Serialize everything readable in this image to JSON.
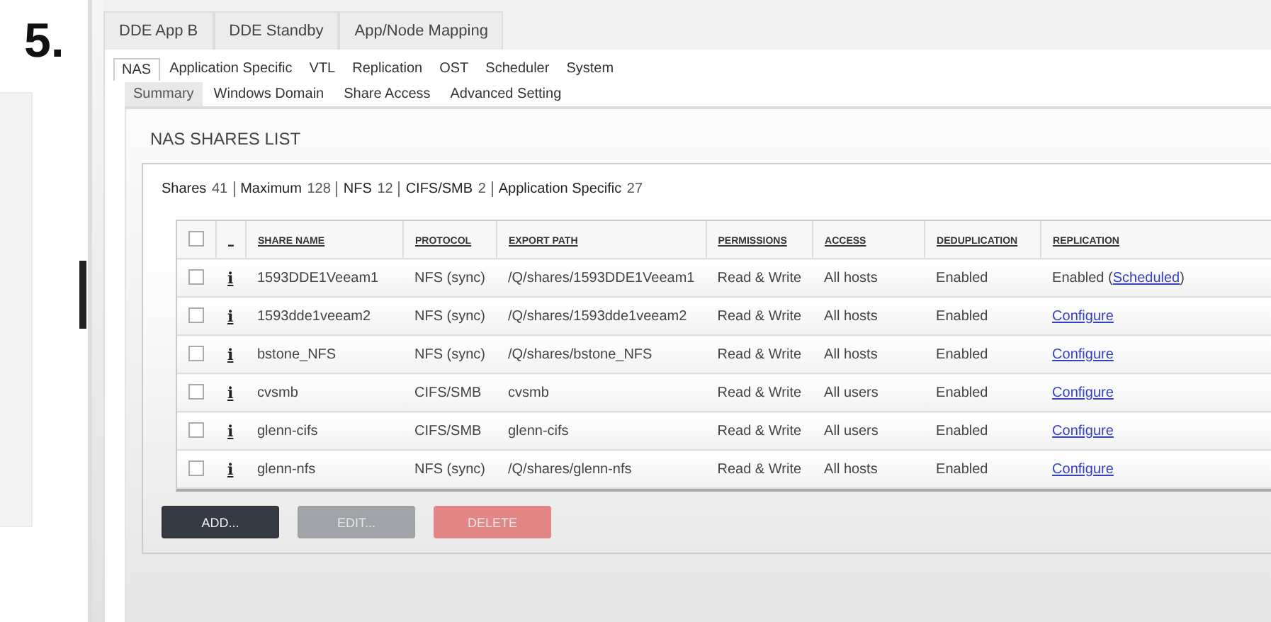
{
  "step_label": "5.",
  "top_tabs": [
    {
      "label": "DDE App B",
      "selected": false
    },
    {
      "label": "DDE Standby",
      "selected": false
    },
    {
      "label": "App/Node Mapping",
      "selected": false
    }
  ],
  "section_tabs": [
    {
      "label": "NAS",
      "selected": true
    },
    {
      "label": "Application Specific",
      "selected": false
    },
    {
      "label": "VTL",
      "selected": false
    },
    {
      "label": "Replication",
      "selected": false
    },
    {
      "label": "OST",
      "selected": false
    },
    {
      "label": "Scheduler",
      "selected": false
    },
    {
      "label": "System",
      "selected": false
    }
  ],
  "sub_tabs": [
    {
      "label": "Summary",
      "selected": true
    },
    {
      "label": "Windows Domain",
      "selected": false
    },
    {
      "label": "Share Access",
      "selected": false
    },
    {
      "label": "Advanced Setting",
      "selected": false
    }
  ],
  "heading": "NAS SHARES LIST",
  "stats": [
    {
      "label": "Shares",
      "value": "41"
    },
    {
      "label": "Maximum",
      "value": "128"
    },
    {
      "label": "NFS",
      "value": "12"
    },
    {
      "label": "CIFS/SMB",
      "value": "2"
    },
    {
      "label": "Application Specific",
      "value": "27"
    }
  ],
  "table": {
    "select_all_checked": false,
    "columns": [
      "_",
      "SHARE NAME",
      "PROTOCOL",
      "EXPORT PATH",
      "PERMISSIONS",
      "ACCESS",
      "DEDUPLICATION",
      "REPLICATION"
    ],
    "rows": [
      {
        "checked": false,
        "info": "i",
        "name": "1593DDE1Veeam1",
        "protocol": "NFS (sync)",
        "path": "/Q/shares/1593DDE1Veeam1",
        "permissions": "Read & Write",
        "access": "All hosts",
        "dedup": "Enabled",
        "replication": {
          "kind": "status",
          "prefix": "Enabled (",
          "link": "Scheduled",
          "suffix": ")"
        }
      },
      {
        "checked": false,
        "info": "i",
        "name": "1593dde1veeam2",
        "protocol": "NFS (sync)",
        "path": "/Q/shares/1593dde1veeam2",
        "permissions": "Read & Write",
        "access": "All hosts",
        "dedup": "Enabled",
        "replication": {
          "kind": "link",
          "link": "Configure"
        }
      },
      {
        "checked": false,
        "info": "i",
        "name": "bstone_NFS",
        "protocol": "NFS (sync)",
        "path": "/Q/shares/bstone_NFS",
        "permissions": "Read & Write",
        "access": "All hosts",
        "dedup": "Enabled",
        "replication": {
          "kind": "link",
          "link": "Configure"
        }
      },
      {
        "checked": false,
        "info": "i",
        "name": "cvsmb",
        "protocol": "CIFS/SMB",
        "path": "cvsmb",
        "permissions": "Read & Write",
        "access": "All users",
        "dedup": "Enabled",
        "replication": {
          "kind": "link",
          "link": "Configure"
        }
      },
      {
        "checked": false,
        "info": "i",
        "name": "glenn-cifs",
        "protocol": "CIFS/SMB",
        "path": "glenn-cifs",
        "permissions": "Read & Write",
        "access": "All users",
        "dedup": "Enabled",
        "replication": {
          "kind": "link",
          "link": "Configure"
        }
      },
      {
        "checked": false,
        "info": "i",
        "name": "glenn-nfs",
        "protocol": "NFS (sync)",
        "path": "/Q/shares/glenn-nfs",
        "permissions": "Read & Write",
        "access": "All hosts",
        "dedup": "Enabled",
        "replication": {
          "kind": "link",
          "link": "Configure"
        }
      }
    ]
  },
  "buttons": [
    {
      "label": "ADD...",
      "kind": "primary",
      "disabled": false
    },
    {
      "label": "EDIT...",
      "kind": "secondary",
      "disabled": true
    },
    {
      "label": "DELETE",
      "kind": "danger",
      "disabled": true
    }
  ]
}
